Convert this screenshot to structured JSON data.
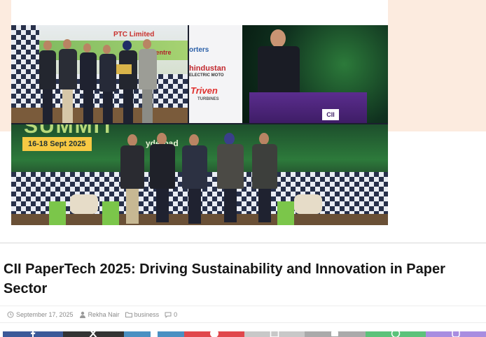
{
  "photo": {
    "panel1_title": "PTC Limited",
    "panel1_sub": "Centre",
    "panel2_brand_a": "orters",
    "panel2_brand_b": "hindustan",
    "panel2_brand_b_sub": "ELECTRIC MOTO",
    "panel2_brand_c": "Triven",
    "panel2_brand_c_sub": "TURBINES",
    "panel2_logo": "CII",
    "panel3_banner": "SUMMIT",
    "panel3_dates": "16-18 Sept 2025",
    "panel3_city": "yderbad"
  },
  "article": {
    "title": "CII PaperTech 2025: Driving Sustainability and Innovation in Paper Sector",
    "date": "September 17, 2025",
    "author": "Rekha Nair",
    "category": "business",
    "comments": "0"
  },
  "share": {
    "buttons": [
      {
        "icon": "facebook-icon",
        "color": "#3b5998"
      },
      {
        "icon": "x-icon",
        "color": "#333333"
      },
      {
        "icon": "linkedin-icon",
        "color": "#4a90c2"
      },
      {
        "icon": "pinterest-icon",
        "color": "#e0474c"
      },
      {
        "icon": "email-icon",
        "color": "#c8c8c8"
      },
      {
        "icon": "print-icon",
        "color": "#aaaaaa"
      },
      {
        "icon": "whatsapp-icon",
        "color": "#5cc27a"
      },
      {
        "icon": "viber-icon",
        "color": "#a88de0"
      }
    ]
  }
}
